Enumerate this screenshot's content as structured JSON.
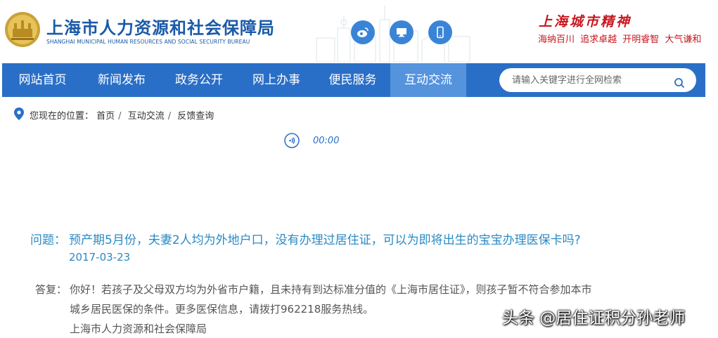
{
  "header": {
    "title": "上海市人力资源和社会保障局",
    "subtitle": "SHANGHAI MUNICIPAL HUMAN RESOURCES AND SOCIAL SECURITY BUREAU",
    "spirit_title": "上海城市精神",
    "spirit_motto": "海纳百川 追求卓越 开明睿智 大气谦和",
    "icons": [
      "weibo-icon",
      "computer-icon",
      "mobile-icon"
    ]
  },
  "nav": {
    "items": [
      "网站首页",
      "新闻发布",
      "政务公开",
      "网上办事",
      "便民服务",
      "互动交流"
    ],
    "active_index": 5
  },
  "search": {
    "placeholder": "请输入关键字进行全网检索"
  },
  "breadcrumb": {
    "label": "您现在的位置：",
    "items": [
      "首页",
      "互动交流",
      "反馈查询"
    ]
  },
  "audio": {
    "time": "00:00"
  },
  "qa": {
    "question_label": "问题：",
    "question": "预产期5月份，夫妻2人均为外地户口，没有办理过居住证，可以为即将出生的宝宝办理医保卡吗?",
    "date": "2017-03-23",
    "answer_label": "答复：",
    "answer_lines": [
      "你好！若孩子及父母双方均为外省市户籍，且未持有到达标准分值的《上海市居住证》，则孩子暂不符合参加本市",
      "城乡居民医保的条件。更多医保信息，请拨打962218服务热线。",
      "上海市人力资源和社会保障局"
    ]
  },
  "watermark": "头条 @居住证积分孙老师",
  "colors": {
    "nav_bg": "#2a6fc7",
    "nav_active": "#5593dd",
    "brand_blue": "#1a5aa8",
    "question_blue": "#2a8ac4",
    "spirit_red": "#c8161d"
  }
}
